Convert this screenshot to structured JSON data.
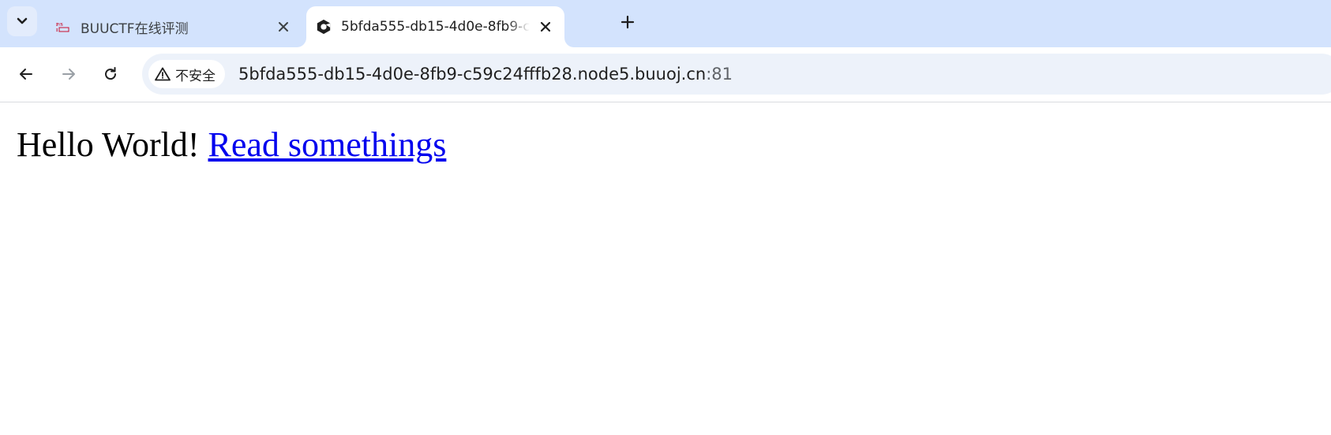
{
  "tabs": [
    {
      "title": "BUUCTF在线评测",
      "active": false,
      "favicon": "buuctf-logo-icon"
    },
    {
      "title": "5bfda555-db15-4d0e-8fb9-c59c24fffb28.node5.buuoj.cn:81",
      "active": true,
      "favicon": "site-logo-icon"
    }
  ],
  "omnibox": {
    "security_label": "不安全",
    "url_host": "5bfda555-db15-4d0e-8fb9-c59c24fffb28.node5.buuoj.cn",
    "url_port": ":81"
  },
  "page": {
    "hello_text": "Hello World!",
    "link_text": "Read somethings"
  },
  "colors": {
    "tabstrip_bg": "#d3e3fd",
    "omnibox_bg": "#edf2fa",
    "link": "#0000ee"
  },
  "icons": [
    "tab-search-icon",
    "close-icon",
    "new-tab-plus-icon",
    "back-arrow-icon",
    "forward-arrow-icon",
    "reload-icon",
    "warning-icon"
  ]
}
